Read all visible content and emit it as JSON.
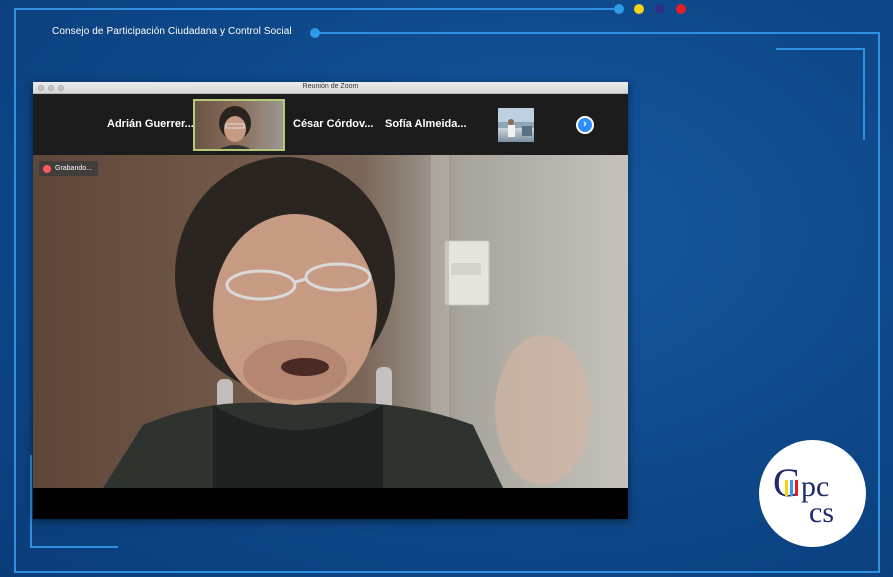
{
  "header": {
    "org_title": "Consejo de Participación Ciudadana y Control Social"
  },
  "decor": {
    "dot_colors": [
      "#2f9ae8",
      "#f5d316",
      "#2c2f8a",
      "#e21f26"
    ],
    "line_color": "#2f8fe0",
    "background": "#0e4889"
  },
  "zoom": {
    "window_title": "Reunión de Zoom",
    "participants": [
      {
        "name": "Adrián Guerrer..."
      },
      {
        "name": "César Córdov..."
      },
      {
        "name": "Sofía Almeida..."
      }
    ],
    "next_icon": "chevron-right-icon",
    "recording_label": "Grabando..."
  },
  "logo": {
    "text": "Cpccs"
  }
}
